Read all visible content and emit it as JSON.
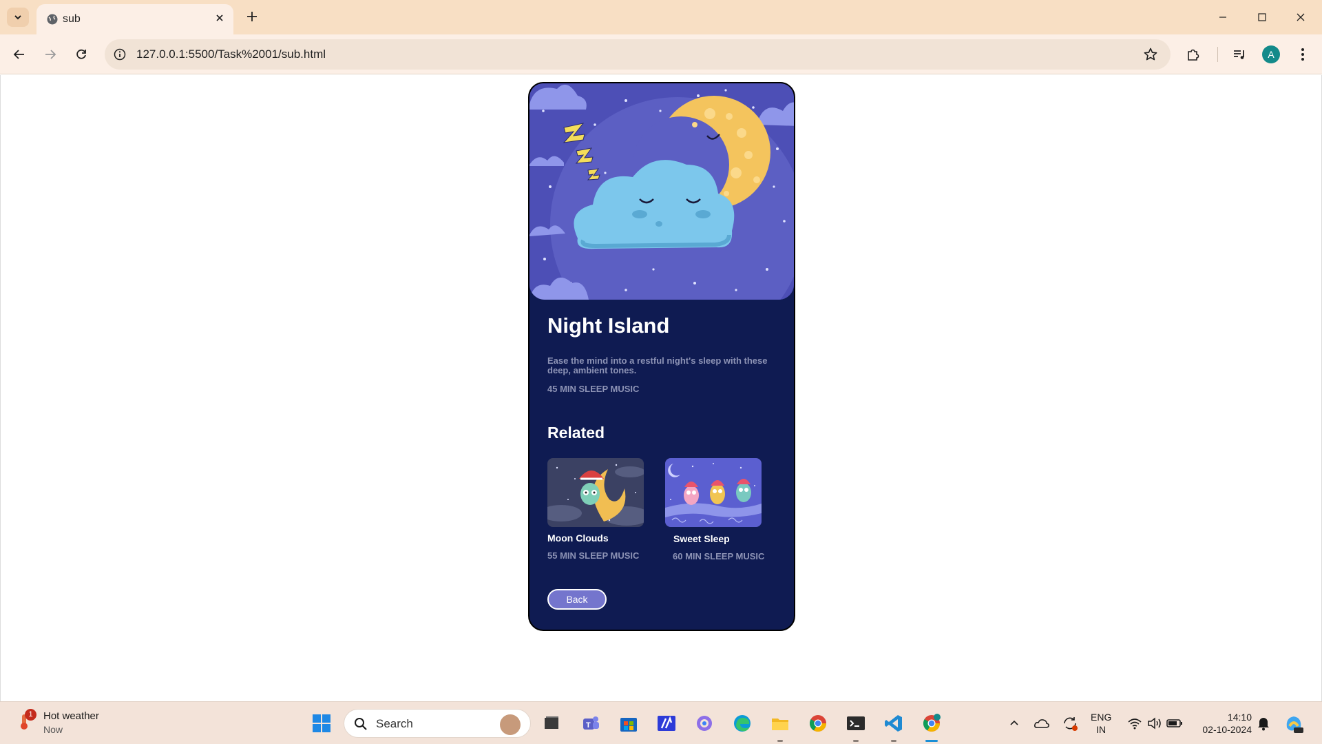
{
  "browser": {
    "tab_title": "sub",
    "url": "127.0.0.1:5500/Task%2001/sub.html",
    "profile_initial": "A"
  },
  "page": {
    "title": "Night Island",
    "description": "Ease the mind into a restful night's sleep with these deep, ambient tones.",
    "meta": "45 MIN SLEEP MUSIC",
    "related_heading": "Related",
    "related": [
      {
        "title": "Moon Clouds",
        "meta": "55 MIN SLEEP MUSIC"
      },
      {
        "title": "Sweet Sleep",
        "meta": "60 MIN SLEEP MUSIC"
      }
    ],
    "back_label": "Back"
  },
  "colors": {
    "card_bg": "#0f1b52",
    "hero_bg": "#4d4fb6",
    "button_bg": "#7475cd",
    "muted_text": "#8d93b5"
  },
  "taskbar": {
    "weather_title": "Hot weather",
    "weather_sub": "Now",
    "weather_badge": "1",
    "search_placeholder": "Search",
    "lang_top": "ENG",
    "lang_bottom": "IN",
    "time": "14:10",
    "date": "02-10-2024"
  },
  "icons": [
    "chevron-down-icon",
    "globe-icon",
    "close-icon",
    "plus-icon",
    "minimize-icon",
    "maximize-icon",
    "back-arrow-icon",
    "forward-arrow-icon",
    "reload-icon",
    "info-icon",
    "star-icon",
    "extensions-icon",
    "media-icon",
    "more-icon",
    "windows-start-icon",
    "search-icon",
    "wifi-icon",
    "volume-icon",
    "battery-icon",
    "bell-icon"
  ]
}
